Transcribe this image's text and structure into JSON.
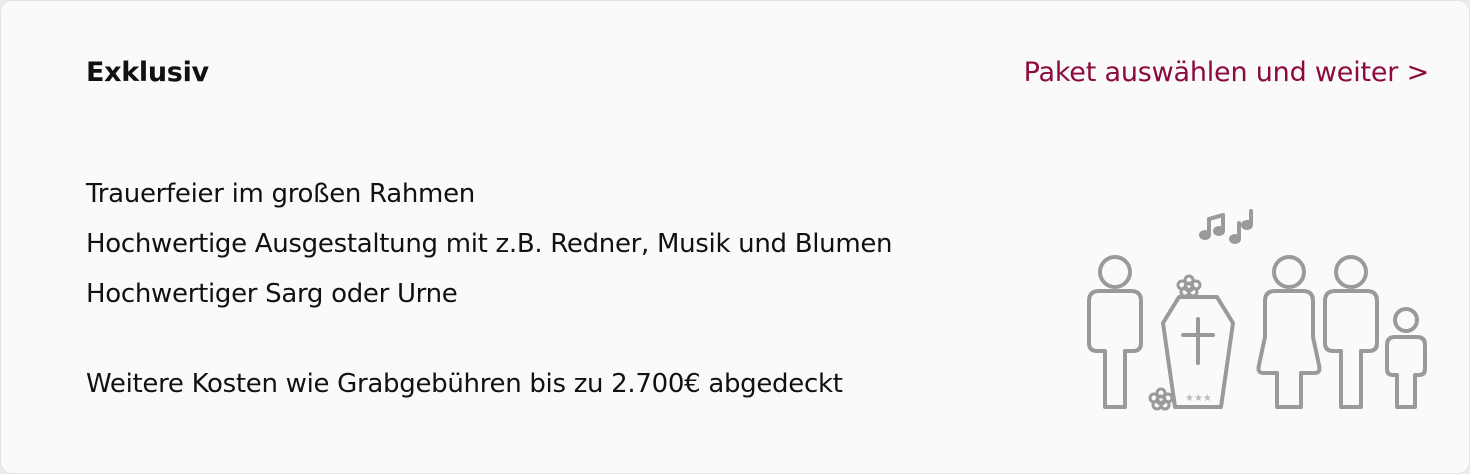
{
  "package": {
    "title": "Exklusiv",
    "select_link": "Paket auswählen und weiter >",
    "features": [
      "Trauerfeier im großen Rahmen",
      "Hochwertige Ausgestaltung mit z.B. Redner, Musik und Blumen",
      "Hochwertiger Sarg oder Urne"
    ],
    "note": "Weitere Kosten wie Grabgebühren bis zu 2.700€ abgedeckt"
  },
  "illustration": {
    "icon": "funeral-family-icon",
    "stroke_color": "#9a9a9a"
  },
  "colors": {
    "accent": "#8c0a3e",
    "text": "#111111",
    "card_background": "#fafafa"
  }
}
